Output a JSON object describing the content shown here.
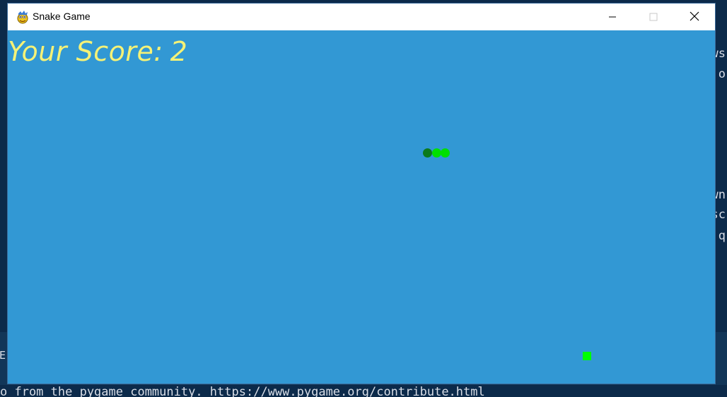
{
  "window": {
    "title": "Snake Game",
    "app_icon": "pygame-snake-icon",
    "controls": {
      "minimize_icon": "minimize-icon",
      "maximize_icon": "maximize-icon",
      "close_icon": "close-icon"
    }
  },
  "game": {
    "score_label": "Your Score:",
    "score_value": "2",
    "background_color": "#3298d4",
    "score_color": "#f5f277",
    "snake": {
      "head_color": "#0b7a1c",
      "body_color": "#00e000",
      "segments": [
        "head",
        "body",
        "body"
      ]
    },
    "food": {
      "color": "#00ff00"
    }
  },
  "background_terminal": {
    "bottom_line": "o from the pygame community. https://www.pygame.org/contribute.html",
    "right_fragments": [
      "ws",
      "o",
      "wn",
      "sc",
      "q"
    ],
    "left_fragment": "E"
  }
}
